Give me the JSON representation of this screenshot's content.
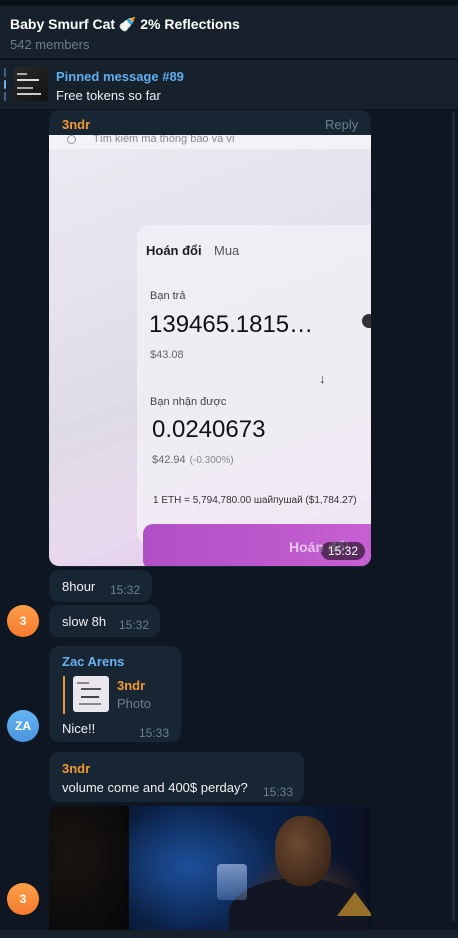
{
  "header": {
    "title": "Baby Smurf Cat 🍼 2% Reflections",
    "members": "542 members"
  },
  "pinned": {
    "title": "Pinned message #89",
    "text": "Free tokens so far"
  },
  "messages": [
    {
      "sender": "3ndr",
      "reply_label": "Reply",
      "photo": {
        "search_hint": "Tìm kiếm mã thông báo và ví",
        "tab_swap": "Hoán đổi",
        "tab_buy": "Mua",
        "pay_label": "Bạn trả",
        "pay_amount": "139465.1815…",
        "pay_usd": "$43.08",
        "receive_label": "Bạn nhận được",
        "receive_amount": "0.0240673",
        "receive_usd": "$42.94",
        "receive_pct": "(-0.300%)",
        "rate": "1 ETH = 5,794,780.00 шайпушай ($1,784.27)",
        "button": "Hoán đổi"
      },
      "time": "15:32"
    },
    {
      "text": "8hour",
      "time": "15:32"
    },
    {
      "text": "slow 8h",
      "time": "15:32",
      "avatar": "3"
    },
    {
      "sender": "Zac Arens",
      "quote": {
        "author": "3ndr",
        "type": "Photo"
      },
      "text": "Nice!!",
      "time": "15:33",
      "avatar": "ZA"
    },
    {
      "sender": "3ndr",
      "text": "volume come and 400$ perday?",
      "time": "15:33",
      "avatar": "3"
    }
  ],
  "colors": {
    "background": "#0e1621",
    "bubble": "#182533",
    "link": "#5eaef0",
    "sender_orange": "#f09a35",
    "sender_blue": "#6ab2f2"
  }
}
